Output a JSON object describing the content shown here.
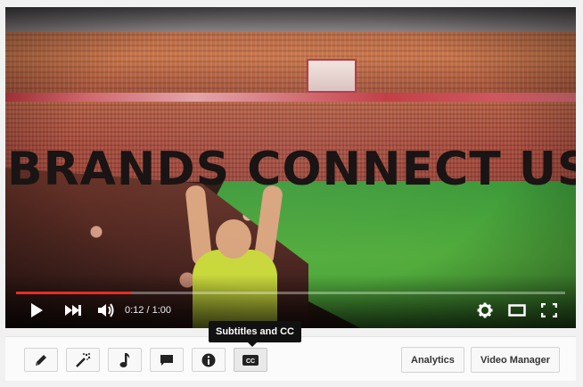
{
  "video": {
    "overlay_title": "BRANDS CONNECT US",
    "time_display": "0:12 / 1:00",
    "progress_fraction": 0.21
  },
  "controls": {
    "play_icon": "play-icon",
    "next_icon": "skip-next-icon",
    "volume_icon": "volume-icon",
    "settings_icon": "gear-icon",
    "theater_icon": "theater-mode-icon",
    "fullscreen_icon": "fullscreen-icon",
    "progress_color": "#e52d27"
  },
  "toolbar": {
    "buttons": [
      {
        "icon": "pencil-icon"
      },
      {
        "icon": "magic-wand-icon"
      },
      {
        "icon": "music-note-icon"
      },
      {
        "icon": "annotation-icon"
      },
      {
        "icon": "info-icon"
      },
      {
        "icon": "cc-icon",
        "icon_text": "CC"
      }
    ],
    "analytics_label": "Analytics",
    "video_manager_label": "Video Manager",
    "tooltip": "Subtitles and CC"
  }
}
